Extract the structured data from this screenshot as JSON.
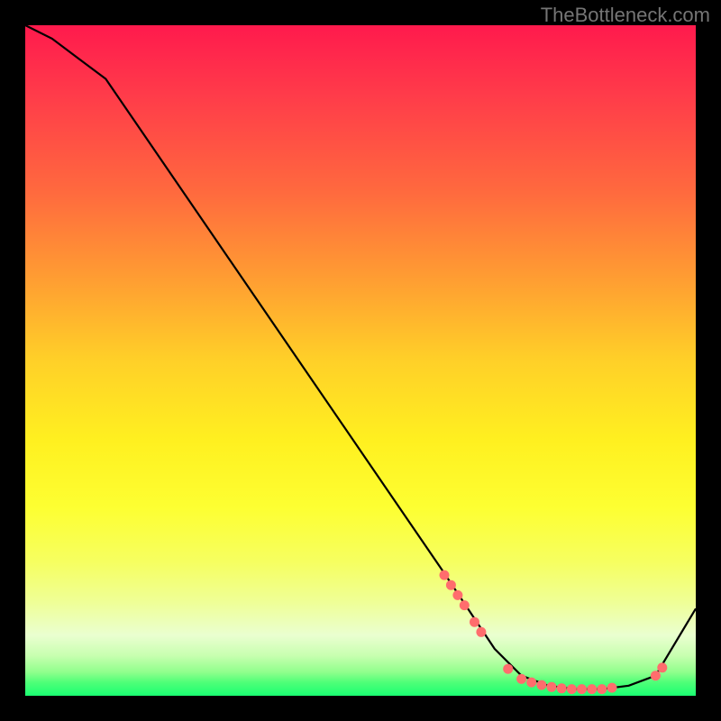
{
  "attribution": "TheBottleneck.com",
  "colors": {
    "dot": "#ff6d6d",
    "curve": "#000000"
  },
  "chart_data": {
    "type": "line",
    "title": "",
    "xlabel": "",
    "ylabel": "",
    "xlim": [
      0,
      100
    ],
    "ylim": [
      0,
      100
    ],
    "grid": false,
    "legend": false,
    "series": [
      {
        "name": "curve",
        "x": [
          0,
          4,
          8,
          12,
          62,
          70,
          74,
          78,
          82,
          86,
          90,
          94,
          100
        ],
        "values": [
          100,
          98,
          95,
          92,
          19,
          7,
          3,
          1.5,
          1,
          1,
          1.5,
          3,
          13
        ]
      }
    ],
    "dots": {
      "name": "highlighted-points",
      "x": [
        62.5,
        63.5,
        64.5,
        65.5,
        67,
        68,
        72,
        74,
        75.5,
        77,
        78.5,
        80,
        81.5,
        83,
        84.5,
        86,
        87.5,
        94,
        95
      ],
      "values": [
        18,
        16.5,
        15,
        13.5,
        11,
        9.5,
        4,
        2.5,
        2,
        1.6,
        1.3,
        1.1,
        1.0,
        1.0,
        1.0,
        1.0,
        1.2,
        3.0,
        4.2
      ]
    }
  }
}
